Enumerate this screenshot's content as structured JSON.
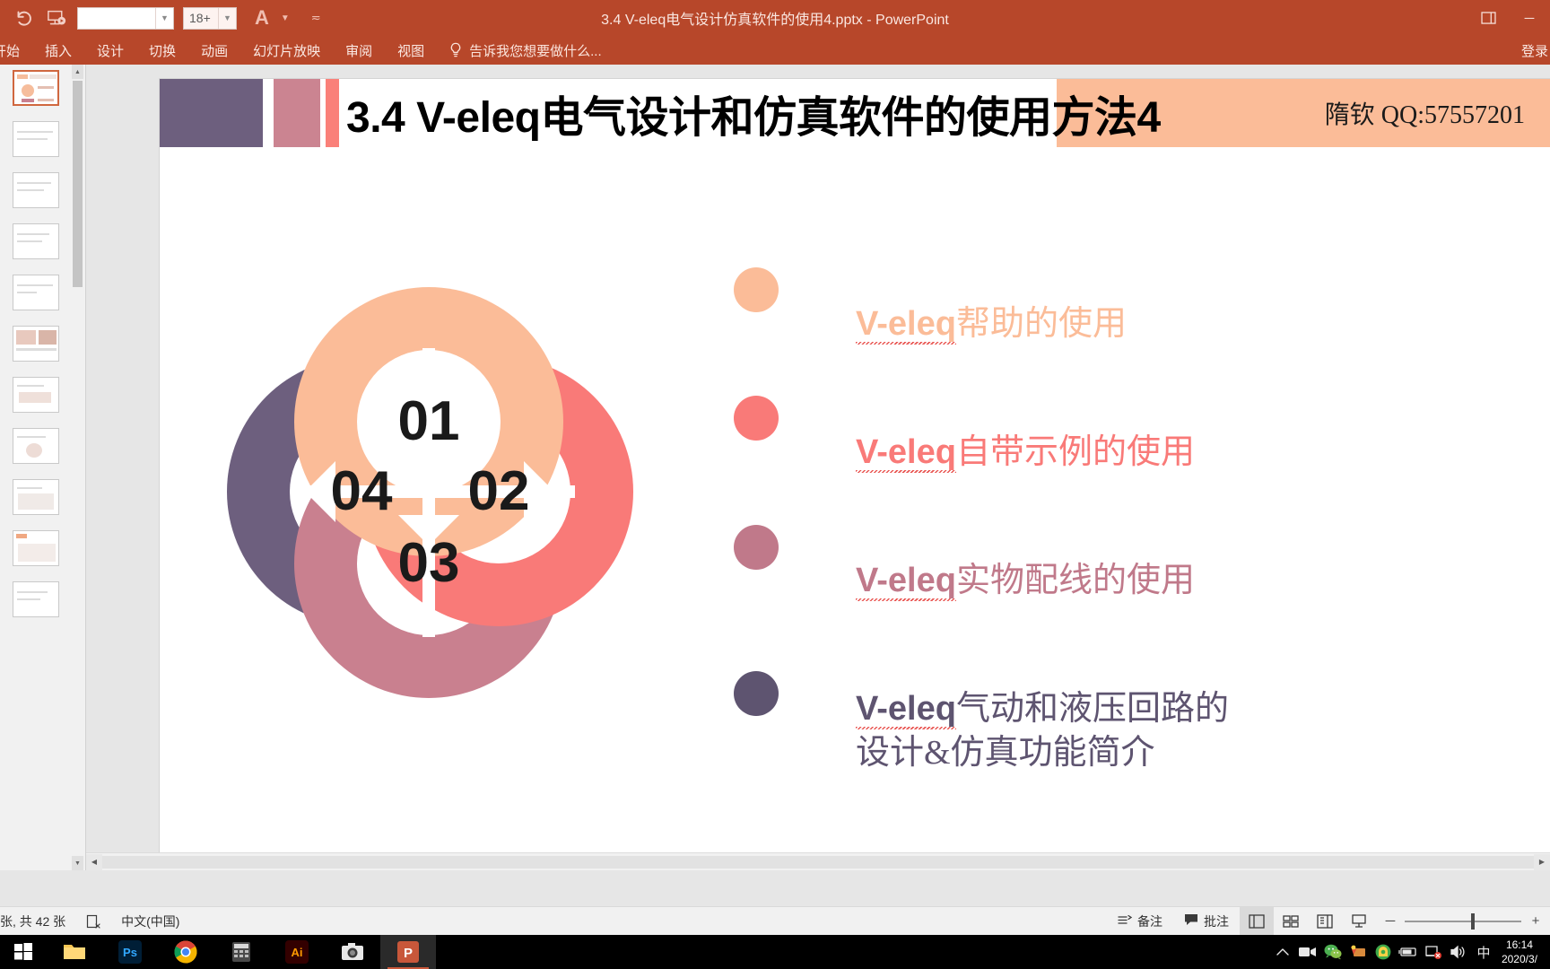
{
  "titlebar": {
    "document_title": "3.4 V-eleq电气设计仿真软件的使用4.pptx - PowerPoint",
    "qat": {
      "undo_icon": "undo-icon",
      "present_icon": "start-slideshow-icon",
      "style_box_value": "",
      "font_size_value": "18+",
      "font_color_label": "A"
    },
    "window_buttons": {
      "ribbon_display": "❐",
      "minimize": "─",
      "restore": "❐",
      "close": "✕"
    }
  },
  "ribbon": {
    "tabs": [
      {
        "label": "开始"
      },
      {
        "label": "插入"
      },
      {
        "label": "设计"
      },
      {
        "label": "切换"
      },
      {
        "label": "动画"
      },
      {
        "label": "幻灯片放映"
      },
      {
        "label": "审阅"
      },
      {
        "label": "视图"
      }
    ],
    "tell_me": "告诉我您想要做什么...",
    "sign_in": "登录"
  },
  "slide": {
    "header": {
      "title": "3.4 V-eleq电气设计和仿真软件的使用方法4",
      "author": "隋钦 QQ:57557201",
      "accent_purple": "#6d5f7e",
      "accent_mauve": "#cb8491",
      "accent_coral": "#fa8079",
      "band_color": "#fbbc98"
    },
    "diagram": {
      "type": "4-step circular arrow infographic",
      "segments": [
        {
          "number": "01",
          "position": "top",
          "color": "#fbbc98"
        },
        {
          "number": "02",
          "position": "right",
          "color": "#f97a78"
        },
        {
          "number": "03",
          "position": "bottom",
          "color": "#c9808f"
        },
        {
          "number": "04",
          "position": "left",
          "color": "#6d5f7e"
        }
      ]
    },
    "bullets": [
      {
        "dot_color": "#fbbc98",
        "text_color": "#fbbc98",
        "latin": "V-eleq",
        "rest": "帮助的使用"
      },
      {
        "dot_color": "#f97a78",
        "text_color": "#f97a78",
        "latin": "V-eleq",
        "rest": "自带示例的使用"
      },
      {
        "dot_color": "#c0798a",
        "text_color": "#c0798a",
        "latin": "V-eleq",
        "rest": "实物配线的使用"
      },
      {
        "dot_color": "#5e5470",
        "text_color": "#5e5470",
        "latin": "V-eleq",
        "rest": "气动和液压回路的\n设计&仿真功能简介"
      }
    ]
  },
  "statusbar": {
    "slide_count": "张, 共 42 张",
    "accessibility_icon": "accessibility-check-icon",
    "language": "中文(中国)",
    "notes_label": "备注",
    "comments_label": "批注",
    "views": [
      {
        "name": "normal-view",
        "glyph": "▣",
        "active": true
      },
      {
        "name": "slide-sorter-view",
        "glyph": "▦",
        "active": false
      },
      {
        "name": "reading-view",
        "glyph": "▤",
        "active": false
      },
      {
        "name": "slideshow-view",
        "glyph": "▽",
        "active": false
      }
    ],
    "zoom_out": "─",
    "zoom_in": "+"
  },
  "taskbar": {
    "start_icon": "windows-start-icon",
    "items": [
      {
        "name": "file-explorer",
        "glyph": "📁",
        "active": false
      },
      {
        "name": "photoshop",
        "glyph": "Ps",
        "active": false
      },
      {
        "name": "chrome",
        "glyph": "◉",
        "active": false
      },
      {
        "name": "calculator",
        "glyph": "▦",
        "active": false
      },
      {
        "name": "illustrator",
        "glyph": "Ai",
        "active": false
      },
      {
        "name": "camera",
        "glyph": "▣",
        "active": false
      },
      {
        "name": "powerpoint",
        "glyph": "P",
        "active": true
      }
    ],
    "tray": [
      {
        "name": "show-hidden-icons",
        "glyph": "∧"
      },
      {
        "name": "screen-recorder-icon",
        "glyph": "▤"
      },
      {
        "name": "wechat-icon",
        "glyph": "◉"
      },
      {
        "name": "notification-icon",
        "glyph": "✦"
      },
      {
        "name": "security-icon",
        "glyph": "◉"
      },
      {
        "name": "battery-icon",
        "glyph": "▭"
      },
      {
        "name": "network-disconnected-icon",
        "glyph": "▣"
      },
      {
        "name": "volume-icon",
        "glyph": "◁"
      },
      {
        "name": "ime-chinese-icon",
        "glyph": "中"
      }
    ],
    "clock_time": "16:14",
    "clock_date": "2020/3/"
  }
}
